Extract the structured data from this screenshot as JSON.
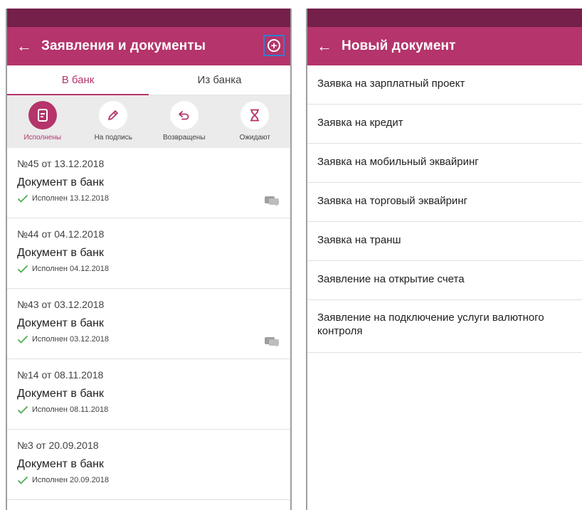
{
  "left_screen": {
    "title": "Заявления и документы",
    "back_icon": "arrow-left-icon",
    "add_icon": "plus-circle-icon",
    "tabs": [
      {
        "label": "В банк",
        "active": true
      },
      {
        "label": "Из банка",
        "active": false
      }
    ],
    "filters": [
      {
        "label": "Исполнены",
        "icon": "document-icon",
        "active": true
      },
      {
        "label": "На подпись",
        "icon": "pencil-icon",
        "active": false
      },
      {
        "label": "Возвращены",
        "icon": "return-arrow-icon",
        "active": false
      },
      {
        "label": "Ожидают",
        "icon": "hourglass-icon",
        "active": false
      }
    ],
    "documents": [
      {
        "number": "№45 от 13.12.2018",
        "name": "Документ в банк",
        "status": "Исполнен 13.12.2018",
        "has_comment": true
      },
      {
        "number": "№44 от 04.12.2018",
        "name": "Документ в банк",
        "status": "Исполнен 04.12.2018",
        "has_comment": false
      },
      {
        "number": "№43 от 03.12.2018",
        "name": "Документ в банк",
        "status": "Исполнен 03.12.2018",
        "has_comment": true
      },
      {
        "number": "№14 от 08.11.2018",
        "name": "Документ в банк",
        "status": "Исполнен 08.11.2018",
        "has_comment": false
      },
      {
        "number": "№3 от 20.09.2018",
        "name": "Документ в банк",
        "status": "Исполнен 20.09.2018",
        "has_comment": false
      }
    ]
  },
  "right_screen": {
    "title": "Новый документ",
    "back_icon": "arrow-left-icon",
    "items": [
      "Заявка на зарплатный проект",
      "Заявка на кредит",
      "Заявка на мобильный эквайринг",
      "Заявка на торговый эквайринг",
      "Заявка на транш",
      "Заявление на открытие счета",
      "Заявление на подключение услуги валютного контроля"
    ]
  },
  "colors": {
    "status_bar": "#74204a",
    "app_bar": "#b4346b",
    "accent": "#b4346b",
    "success": "#4caf50",
    "highlight_border": "#2f7fd0"
  }
}
